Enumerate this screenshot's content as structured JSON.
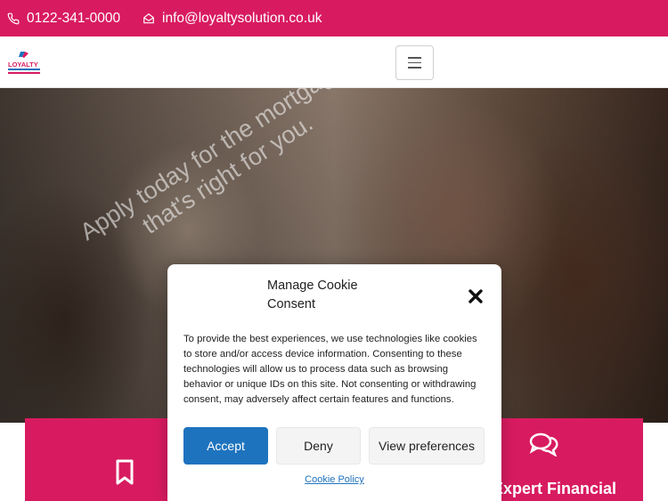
{
  "topbar": {
    "phone": "0122-341-0000",
    "email": "info@loyaltysolution.co.uk",
    "phone_icon": "phone-icon",
    "email_icon": "envelope-icon"
  },
  "header": {
    "logo_text": "LOYALTY",
    "menu_icon": "hamburger-icon"
  },
  "hero": {
    "text": "Apply today for the mortgage that's right for you."
  },
  "cards": {
    "left_icon": "bookmark-icon",
    "right_icon": "chat-bubbles-icon",
    "right_title": "Expert Financial"
  },
  "cookie_modal": {
    "title": "Manage Cookie Consent",
    "body": "To provide the best experiences, we use technologies like cookies to store and/or access device information. Consenting to these technologies will allow us to process data such as browsing behavior or unique IDs on this site. Not consenting or withdrawing consent, may adversely affect certain features and functions.",
    "accept_label": "Accept",
    "deny_label": "Deny",
    "view_label": "View preferences",
    "policy_label": "Cookie Policy",
    "close_icon": "close-icon"
  },
  "colors": {
    "brand": "#d81b60",
    "accent": "#1e73be"
  }
}
